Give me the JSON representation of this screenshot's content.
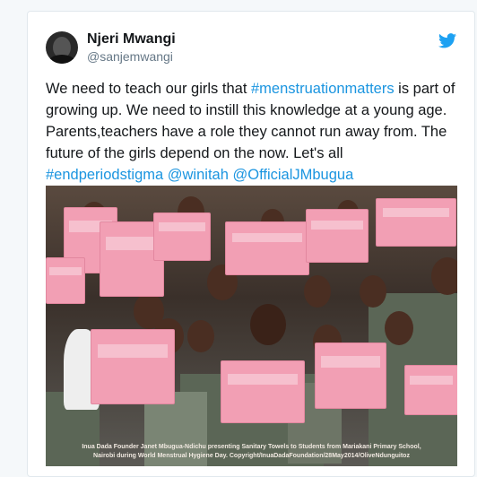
{
  "tweet": {
    "author_name": "Njeri Mwangi",
    "author_handle": "@sanjemwangi",
    "text_parts": [
      {
        "text": "We need to teach our girls that ",
        "link": false
      },
      {
        "text": "#menstruationmatters",
        "link": true
      },
      {
        "text": " is part of growing up. We need to instill this knowledge at a young age. Parents,teachers have a role they cannot run away from. The future of the girls depend on the now. Let's all ",
        "link": false
      },
      {
        "text": "#endperiodstigma",
        "link": true
      },
      {
        "text": " ",
        "link": false
      },
      {
        "text": "@winitah",
        "link": true
      },
      {
        "text": " ",
        "link": false
      },
      {
        "text": "@OfficialJMbugua",
        "link": true
      }
    ]
  },
  "photo": {
    "caption_line1": "Inua Dada Founder Janet Mbugua-Ndichu presenting Sanitary Towels to Students from Mariakani Primary School,",
    "caption_line2": "Nairobi during World Menstrual Hygiene Day. Copyright/InuaDadaFoundation/28May2014/OliveNdunguitoz"
  },
  "colors": {
    "link": "#1b95e0",
    "text": "#14171a",
    "muted": "#657786",
    "twitter_blue": "#1da1f2"
  },
  "icons": {
    "brand": "twitter-bird-icon"
  }
}
